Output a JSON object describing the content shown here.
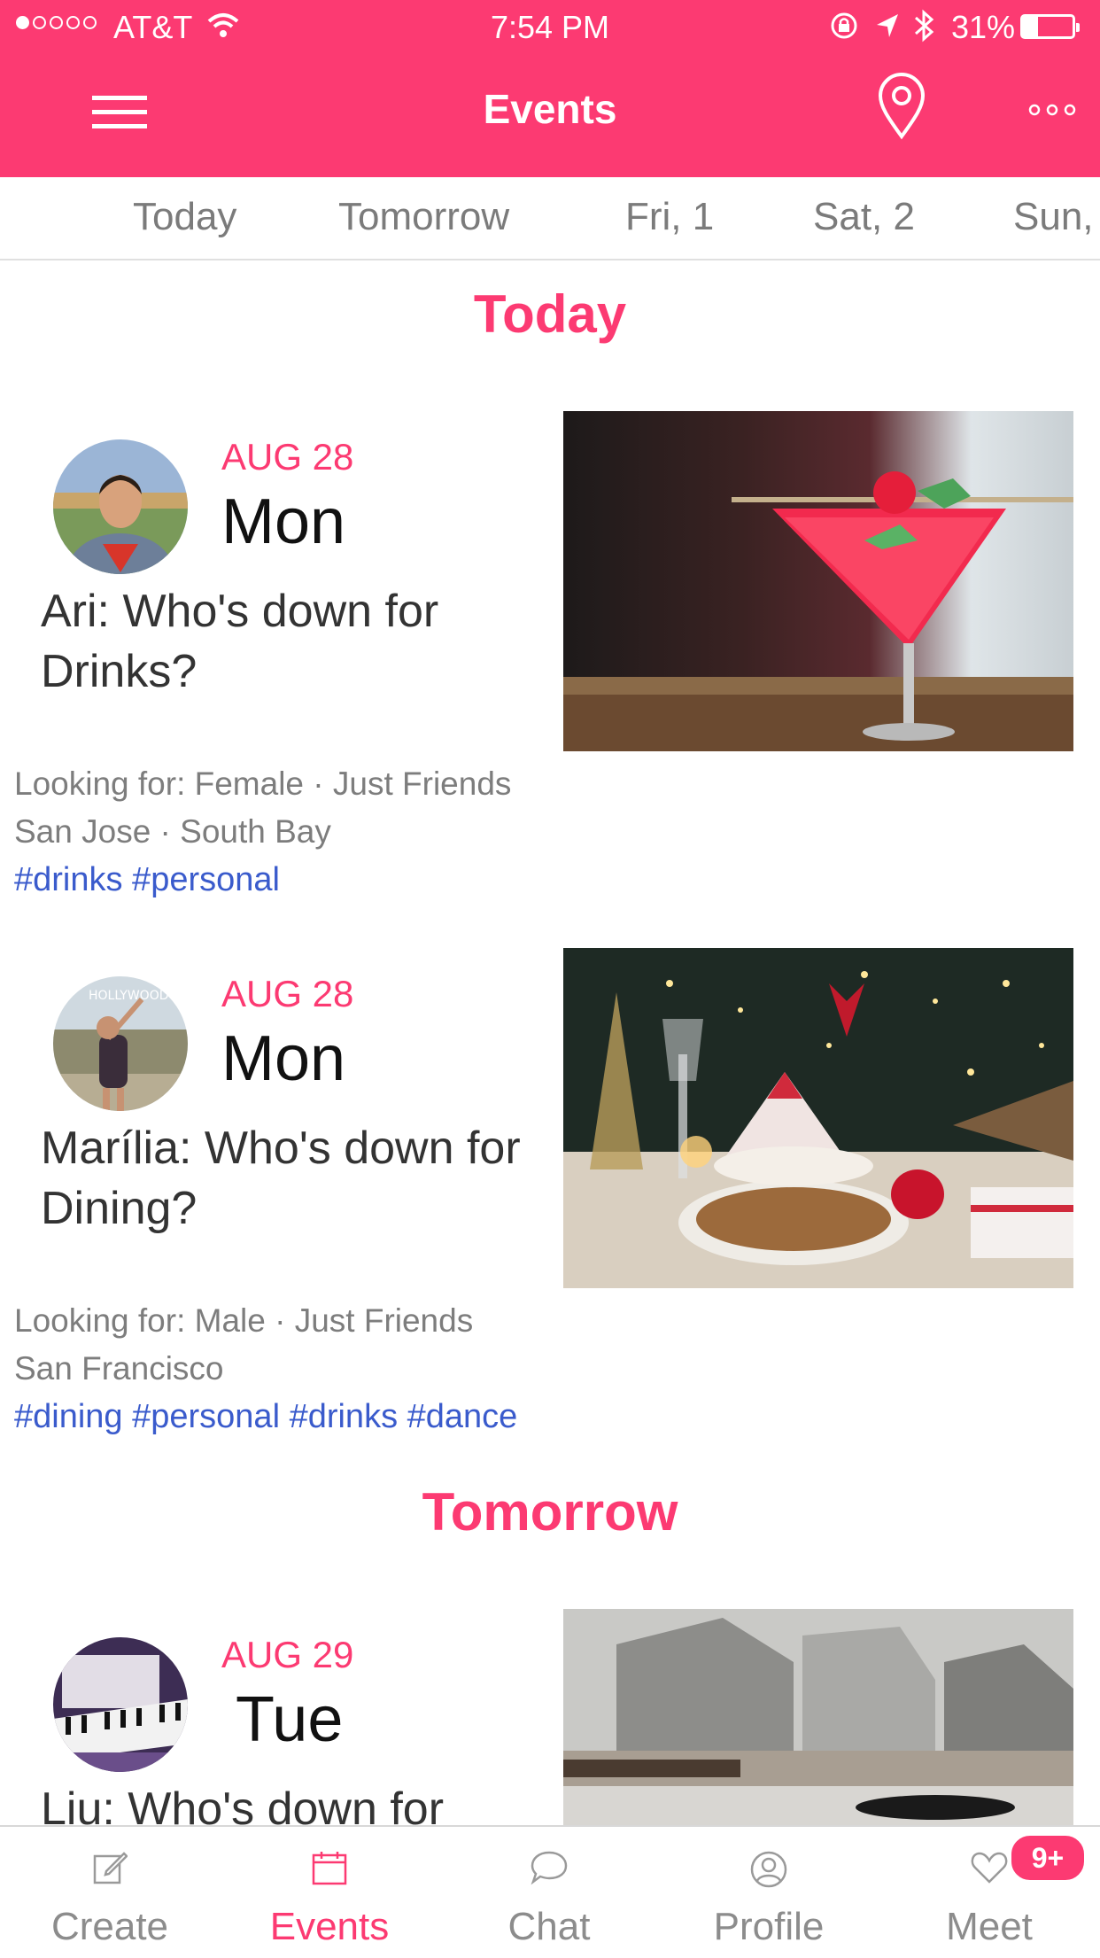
{
  "status_bar": {
    "carrier": "AT&T",
    "time": "7:54 PM",
    "battery": "31%"
  },
  "header": {
    "title": "Events"
  },
  "date_tabs": [
    "Today",
    "Tomorrow",
    "Fri, 1",
    "Sat, 2",
    "Sun,"
  ],
  "sections": {
    "today": "Today",
    "tomorrow": "Tomorrow"
  },
  "events": [
    {
      "month": "AUG 28",
      "dow": "Mon",
      "title": "Ari: Who's down for Drinks?",
      "looking_for": "Looking for: Female · Just Friends",
      "location": "San Jose · South Bay",
      "tags": "#drinks #personal"
    },
    {
      "month": "AUG 28",
      "dow": "Mon",
      "title": "Marília: Who's down for Dining?",
      "looking_for": "Looking for: Male · Just Friends",
      "location": "San Francisco",
      "tags": "#dining #personal #drinks #dance"
    },
    {
      "month": "AUG 29",
      "dow": "Tue",
      "title": "Liu: Who's down for"
    }
  ],
  "nav": {
    "items": [
      "Create",
      "Events",
      "Chat",
      "Profile",
      "Meet"
    ],
    "active": "Events",
    "badge": "9+"
  },
  "colors": {
    "brand": "#fc3a72",
    "tag": "#3a5bcc"
  }
}
